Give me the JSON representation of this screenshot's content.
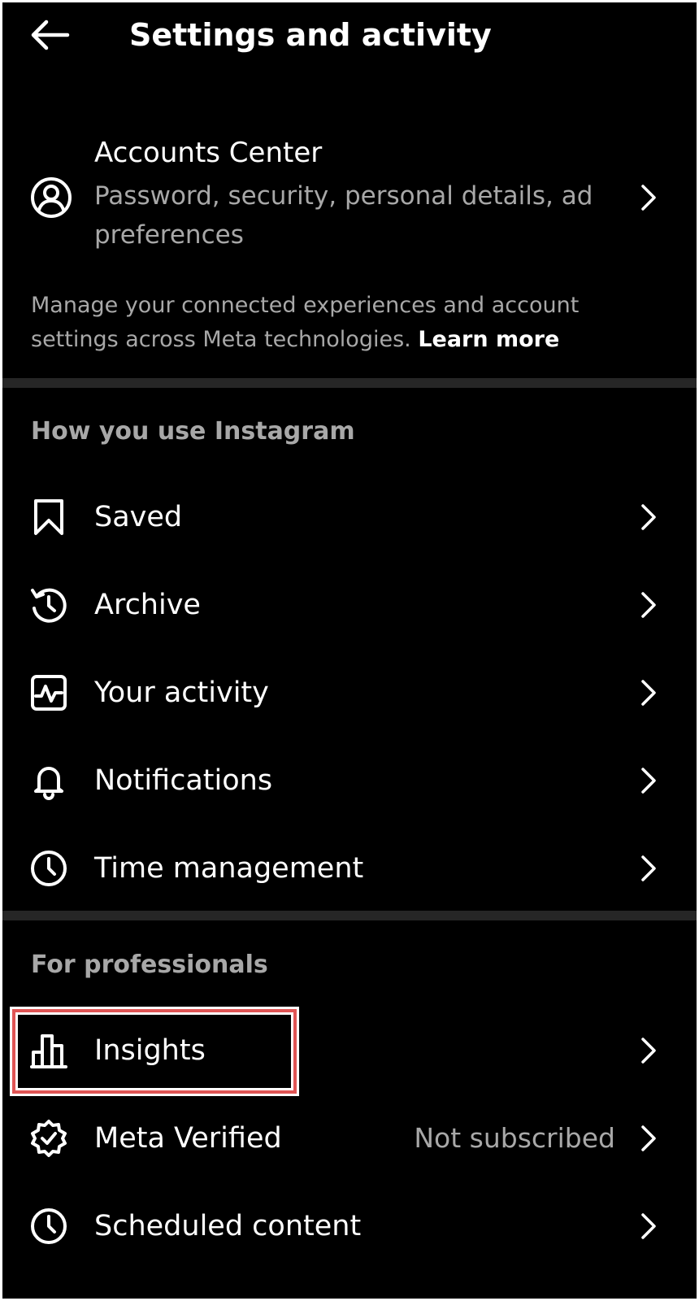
{
  "header": {
    "title": "Settings and activity",
    "back_icon": "arrow-left-icon"
  },
  "accounts_center": {
    "title": "Accounts Center",
    "subtitle": "Password, security, personal details, ad preferences",
    "description": "Manage your connected experiences and account settings across Meta technologies.",
    "learn_more": "Learn more",
    "icon": "user-circle-icon"
  },
  "sections": {
    "how_you_use": {
      "heading": "How you use Instagram",
      "items": [
        {
          "label": "Saved",
          "icon": "bookmark-icon"
        },
        {
          "label": "Archive",
          "icon": "archive-history-icon"
        },
        {
          "label": "Your activity",
          "icon": "activity-icon"
        },
        {
          "label": "Notifications",
          "icon": "bell-icon"
        },
        {
          "label": "Time management",
          "icon": "clock-icon"
        }
      ]
    },
    "professionals": {
      "heading": "For professionals",
      "items": [
        {
          "label": "Insights",
          "icon": "bar-chart-icon"
        },
        {
          "label": "Meta Verified",
          "value": "Not subscribed",
          "icon": "verified-badge-icon"
        },
        {
          "label": "Scheduled content",
          "icon": "clock-icon"
        }
      ]
    }
  },
  "colors": {
    "background": "#000000",
    "text_primary": "#ffffff",
    "text_secondary": "#a8a8a8",
    "divider": "#262626",
    "highlight": "#e05555"
  }
}
